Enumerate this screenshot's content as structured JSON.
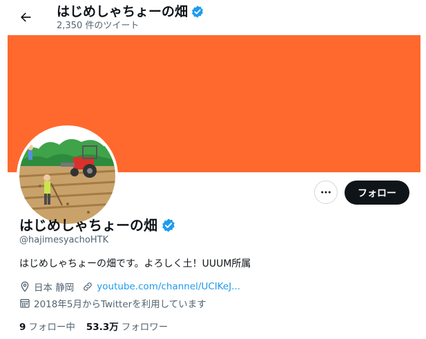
{
  "header": {
    "title": "はじめしゃちょーの畑",
    "tweet_count": "2,350 件のツイート"
  },
  "profile": {
    "name": "はじめしゃちょーの畑",
    "handle": "@hajimesyachoHTK",
    "bio": "はじめしゃちょーの畑です。よろしく土！UUUM所属",
    "location": "日本 静岡",
    "website": "youtube.com/channel/UCIKeJ...",
    "joined": "2018年5月からTwitterを利用しています",
    "following_count": "9",
    "following_label": "フォロー中",
    "followers_count": "53.3万",
    "followers_label": "フォロワー"
  },
  "actions": {
    "follow_label": "フォロー"
  },
  "colors": {
    "banner": "#ff692d",
    "verified": "#1d9bf0",
    "link": "#1d9bf0",
    "follow_button": "#0f1419"
  },
  "icons": [
    "back-arrow-icon",
    "verified-badge-icon",
    "more-icon",
    "location-icon",
    "link-icon",
    "calendar-icon"
  ]
}
